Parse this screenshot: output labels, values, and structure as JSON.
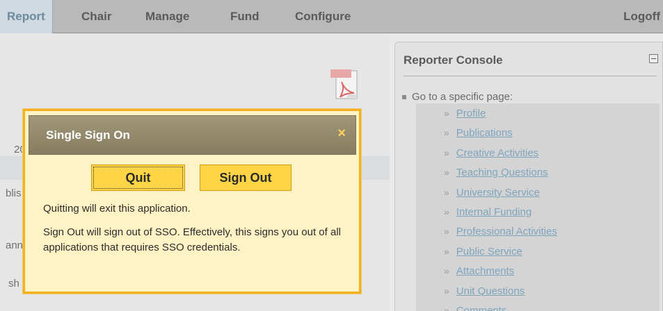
{
  "nav": {
    "tabs": [
      "Report",
      "Chair",
      "Manage",
      "Fund",
      "Configure"
    ],
    "logoff": "Logoff"
  },
  "background_fragments": [
    "20",
    "blis",
    "ann",
    "sh"
  ],
  "console": {
    "title": "Reporter Console",
    "goto_label": "Go to a specific page:",
    "links": [
      "Profile",
      "Publications",
      "Creative Activities",
      "Teaching Questions",
      "University Service",
      "Internal Funding",
      "Professional Activities",
      "Public Service",
      "Attachments",
      "Unit Questions",
      "Comments"
    ]
  },
  "dialog": {
    "title": "Single Sign On",
    "close": "×",
    "quit_label": "Quit",
    "signout_label": "Sign Out",
    "quit_message": "Quitting will exit this application.",
    "signout_message": "Sign Out will sign out of SSO. Effectively, this signs you out of all applications that requires SSO credentials."
  },
  "colors": {
    "dialog_border": "#f3b21b",
    "dialog_bg": "#fff3c5",
    "button_bg": "#ffd545",
    "close_color": "#ffd35c"
  },
  "icons": {
    "pdf": "pdf-icon",
    "collapse": "collapse-icon"
  }
}
